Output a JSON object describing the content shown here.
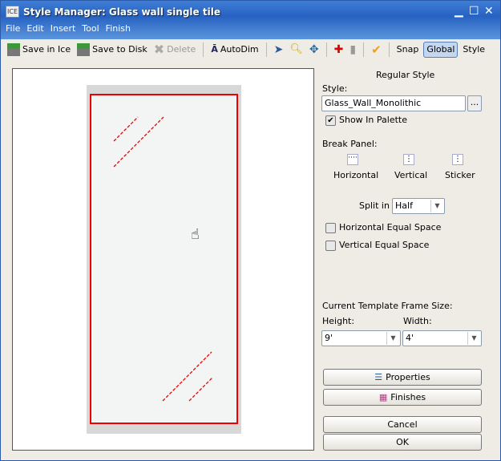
{
  "window": {
    "title": "Style Manager: Glass wall single tile",
    "app_icon": "ICE"
  },
  "menu": [
    "File",
    "Edit",
    "Insert",
    "Tool",
    "Finish"
  ],
  "toolbar": {
    "save_ice": "Save in Ice",
    "save_disk": "Save to Disk",
    "delete": "Delete",
    "autodim": "AutoDim",
    "snap": "Snap",
    "global": "Global",
    "style": "Style"
  },
  "right": {
    "heading": "Regular Style",
    "style_label": "Style:",
    "style_value": "Glass_Wall_Monolithic",
    "browse": "...",
    "show_in_palette": "Show In Palette",
    "break_panel": "Break Panel:",
    "horizontal": "Horizontal",
    "vertical": "Vertical",
    "sticker": "Sticker",
    "split_label": "Split in",
    "split_value": "Half",
    "h_equal": "Horizontal Equal Space",
    "v_equal": "Vertical Equal Space",
    "frame_size": "Current Template Frame Size:",
    "height_label": "Height:",
    "width_label": "Width:",
    "height_value": "9'",
    "width_value": "4'",
    "properties": "Properties",
    "finishes": "Finishes",
    "cancel": "Cancel",
    "ok": "OK"
  },
  "colors": {
    "frame": "#e00000",
    "titlebar": "#2762c2"
  }
}
